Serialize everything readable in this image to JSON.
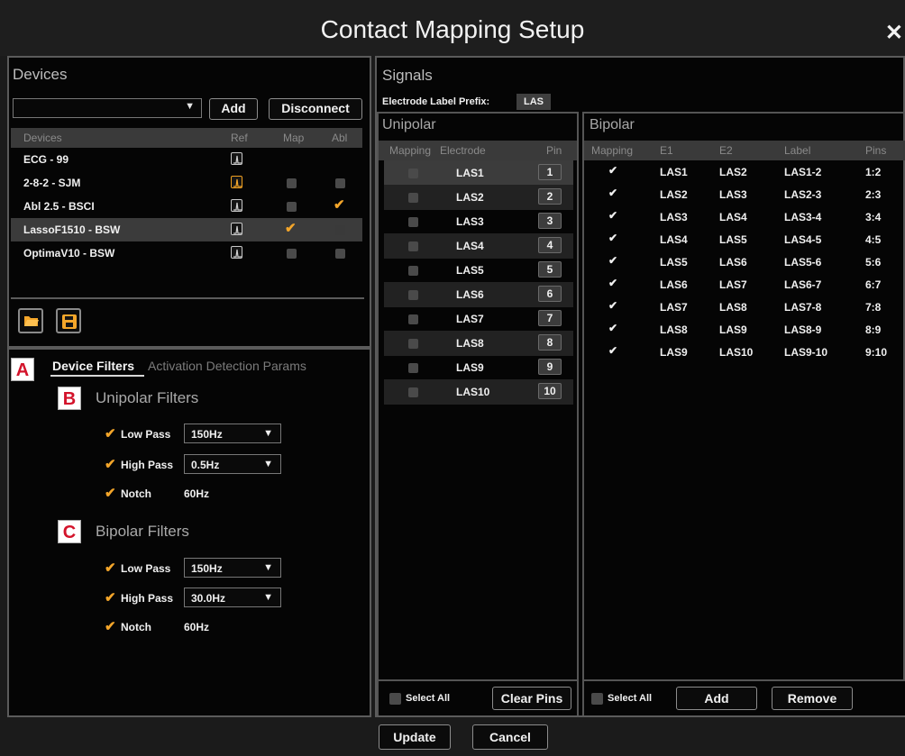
{
  "window": {
    "title": "Contact Mapping Setup",
    "close_glyph": "✕"
  },
  "devices": {
    "section_title": "Devices",
    "add_label": "Add",
    "disconnect_label": "Disconnect",
    "columns": [
      "Devices",
      "Ref",
      "Map",
      "Abl"
    ],
    "rows": [
      {
        "name": "ECG - 99",
        "ref_highlight": false,
        "map": "none",
        "abl": "none",
        "selected": false
      },
      {
        "name": "2-8-2 - SJM",
        "ref_highlight": true,
        "map": "unchecked",
        "abl": "unchecked",
        "selected": false
      },
      {
        "name": "Abl 2.5 - BSCI",
        "ref_highlight": false,
        "map": "unchecked",
        "abl": "checked",
        "selected": false
      },
      {
        "name": "LassoF1510 - BSW",
        "ref_highlight": false,
        "map": "checked",
        "abl": "unchecked",
        "selected": true
      },
      {
        "name": "OptimaV10 - BSW",
        "ref_highlight": false,
        "map": "unchecked",
        "abl": "unchecked",
        "selected": false
      }
    ],
    "toolbar_icons": [
      "folder-open-icon",
      "save-icon"
    ]
  },
  "filters": {
    "markers": {
      "a": "A",
      "b": "B",
      "c": "C"
    },
    "tabs": [
      "Device Filters",
      "Activation Detection Params"
    ],
    "unipolar": {
      "title": "Unipolar Filters",
      "low_pass_label": "Low Pass",
      "low_pass_value": "150Hz",
      "high_pass_label": "High Pass",
      "high_pass_value": "0.5Hz",
      "notch_label": "Notch",
      "notch_value": "60Hz"
    },
    "bipolar": {
      "title": "Bipolar Filters",
      "low_pass_label": "Low Pass",
      "low_pass_value": "150Hz",
      "high_pass_label": "High Pass",
      "high_pass_value": "30.0Hz",
      "notch_label": "Notch",
      "notch_value": "60Hz"
    }
  },
  "signals": {
    "section_title": "Signals",
    "prefix_label": "Electrode Label Prefix:",
    "prefix_value": "LAS",
    "unipolar": {
      "title": "Unipolar",
      "columns": [
        "Mapping",
        "Electrode",
        "Pin"
      ],
      "rows": [
        {
          "electrode": "LAS1",
          "pin": "1"
        },
        {
          "electrode": "LAS2",
          "pin": "2"
        },
        {
          "electrode": "LAS3",
          "pin": "3"
        },
        {
          "electrode": "LAS4",
          "pin": "4"
        },
        {
          "electrode": "LAS5",
          "pin": "5"
        },
        {
          "electrode": "LAS6",
          "pin": "6"
        },
        {
          "electrode": "LAS7",
          "pin": "7"
        },
        {
          "electrode": "LAS8",
          "pin": "8"
        },
        {
          "electrode": "LAS9",
          "pin": "9"
        },
        {
          "electrode": "LAS10",
          "pin": "10"
        }
      ],
      "select_all_label": "Select All",
      "clear_pins_label": "Clear Pins"
    },
    "bipolar": {
      "title": "Bipolar",
      "columns": [
        "Mapping",
        "E1",
        "E2",
        "Label",
        "Pins"
      ],
      "rows": [
        {
          "e1": "LAS1",
          "e2": "LAS2",
          "label": "LAS1-2",
          "pins": "1:2"
        },
        {
          "e1": "LAS2",
          "e2": "LAS3",
          "label": "LAS2-3",
          "pins": "2:3"
        },
        {
          "e1": "LAS3",
          "e2": "LAS4",
          "label": "LAS3-4",
          "pins": "3:4"
        },
        {
          "e1": "LAS4",
          "e2": "LAS5",
          "label": "LAS4-5",
          "pins": "4:5"
        },
        {
          "e1": "LAS5",
          "e2": "LAS6",
          "label": "LAS5-6",
          "pins": "5:6"
        },
        {
          "e1": "LAS6",
          "e2": "LAS7",
          "label": "LAS6-7",
          "pins": "6:7"
        },
        {
          "e1": "LAS7",
          "e2": "LAS8",
          "label": "LAS7-8",
          "pins": "7:8"
        },
        {
          "e1": "LAS8",
          "e2": "LAS9",
          "label": "LAS8-9",
          "pins": "8:9"
        },
        {
          "e1": "LAS9",
          "e2": "LAS10",
          "label": "LAS9-10",
          "pins": "9:10"
        }
      ],
      "select_all_label": "Select All",
      "add_label": "Add",
      "remove_label": "Remove"
    }
  },
  "footer": {
    "update_label": "Update",
    "cancel_label": "Cancel"
  },
  "colors": {
    "accent_check": "#f4a62a",
    "marker_text": "#d3132b"
  }
}
